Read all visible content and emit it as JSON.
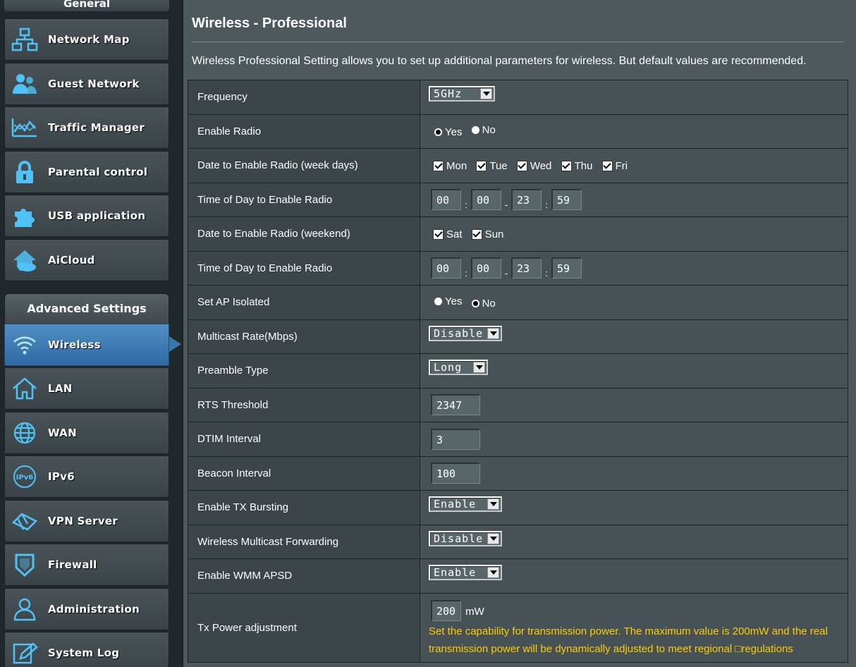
{
  "sidebar": {
    "general_header": "General",
    "general_items": [
      {
        "label": "Network Map",
        "icon": "network-map-icon"
      },
      {
        "label": "Guest Network",
        "icon": "guest-network-icon"
      },
      {
        "label": "Traffic Manager",
        "icon": "traffic-manager-icon"
      },
      {
        "label": "Parental control",
        "icon": "parental-control-icon"
      },
      {
        "label": "USB application",
        "icon": "usb-application-icon"
      },
      {
        "label": "AiCloud",
        "icon": "aicloud-icon"
      }
    ],
    "advanced_header": "Advanced Settings",
    "advanced_items": [
      {
        "label": "Wireless",
        "icon": "wireless-icon",
        "active": true
      },
      {
        "label": "LAN",
        "icon": "lan-icon"
      },
      {
        "label": "WAN",
        "icon": "wan-icon"
      },
      {
        "label": "IPv6",
        "icon": "ipv6-icon"
      },
      {
        "label": "VPN Server",
        "icon": "vpn-server-icon"
      },
      {
        "label": "Firewall",
        "icon": "firewall-icon"
      },
      {
        "label": "Administration",
        "icon": "administration-icon"
      },
      {
        "label": "System Log",
        "icon": "system-log-icon"
      }
    ]
  },
  "main": {
    "title": "Wireless - Professional",
    "description": "Wireless Professional Setting allows you to set up additional parameters for wireless. But default values are recommended."
  },
  "settings": {
    "frequency": {
      "label": "Frequency",
      "value": "5GHz"
    },
    "enable_radio": {
      "label": "Enable Radio",
      "yes": "Yes",
      "no": "No",
      "selected": "Yes"
    },
    "weekdays": {
      "label": "Date to Enable Radio (week days)",
      "days": [
        "Mon",
        "Tue",
        "Wed",
        "Thu",
        "Fri"
      ]
    },
    "weekday_time": {
      "label": "Time of Day to Enable Radio",
      "start_h": "00",
      "start_m": "00",
      "end_h": "23",
      "end_m": "59",
      "colon": ":",
      "dash": "-"
    },
    "weekend": {
      "label": "Date to Enable Radio (weekend)",
      "days": [
        "Sat",
        "Sun"
      ]
    },
    "weekend_time": {
      "label": "Time of Day to Enable Radio",
      "start_h": "00",
      "start_m": "00",
      "end_h": "23",
      "end_m": "59"
    },
    "ap_isolated": {
      "label": "Set AP Isolated",
      "yes": "Yes",
      "no": "No",
      "selected": "No"
    },
    "multicast_rate": {
      "label": "Multicast Rate(Mbps)",
      "value": "Disable"
    },
    "preamble": {
      "label": "Preamble Type",
      "value": "Long"
    },
    "rts": {
      "label": "RTS Threshold",
      "value": "2347"
    },
    "dtim": {
      "label": "DTIM Interval",
      "value": "3"
    },
    "beacon": {
      "label": "Beacon Interval",
      "value": "100"
    },
    "tx_bursting": {
      "label": "Enable TX Bursting",
      "value": "Enable"
    },
    "multicast_forwarding": {
      "label": "Wireless Multicast Forwarding",
      "value": "Disable"
    },
    "wmm_apsd": {
      "label": "Enable WMM APSD",
      "value": "Enable"
    },
    "tx_power": {
      "label": "Tx Power adjustment",
      "value": "200",
      "unit": "mW",
      "hint": "Set the capability for transmission power. The maximum value is 200mW and the real transmission power will be dynamically adjusted to meet regional □regulations"
    }
  },
  "colors": {
    "sidebar_bg": "#21282b",
    "panel_bg": "#4d595d",
    "active_blue": "#3b76ab",
    "hint_yellow": "#ffcc00"
  }
}
